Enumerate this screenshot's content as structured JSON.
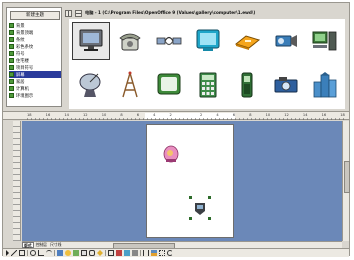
{
  "gallery": {
    "new_theme_label": "新建主题",
    "themes": [
      {
        "label": "背景"
      },
      {
        "label": "背景顶端"
      },
      {
        "label": "条纹"
      },
      {
        "label": "彩色条纹"
      },
      {
        "label": "符号"
      },
      {
        "label": "住宅楼"
      },
      {
        "label": "项目符号"
      },
      {
        "label": "屏幕"
      },
      {
        "label": "家居"
      },
      {
        "label": "计算机"
      },
      {
        "label": "环境图示"
      }
    ],
    "selected_theme_index": 7,
    "path_text": "电脑 - 1 (C:\\Program Files\\OpenOffice 9 (Values\\gallery\\computer\\1.ewd\\)",
    "items": [
      {
        "icon": "computer-monitor-icon"
      },
      {
        "icon": "telephone-icon"
      },
      {
        "icon": "network-cable-icon"
      },
      {
        "icon": "crt-monitor-icon"
      },
      {
        "icon": "disk-drive-icon"
      },
      {
        "icon": "video-camera-icon"
      },
      {
        "icon": "desktop-computer-icon"
      },
      {
        "icon": "satellite-dish-icon"
      },
      {
        "icon": "antenna-tower-icon"
      },
      {
        "icon": "tv-screen-icon"
      },
      {
        "icon": "calculator-icon"
      },
      {
        "icon": "mobile-phone-icon"
      },
      {
        "icon": "camera-icon"
      },
      {
        "icon": "office-building-icon"
      }
    ]
  },
  "ruler": {
    "labels": [
      "18",
      "16",
      "14",
      "12",
      "10",
      "8",
      "6",
      "4",
      "2",
      "",
      "2",
      "4",
      "6",
      "8",
      "10",
      "12",
      "14",
      "16",
      "18"
    ]
  },
  "tabs": [
    {
      "label": "版式"
    },
    {
      "label": "控制层"
    },
    {
      "label": "尺寸线"
    }
  ],
  "active_tab_index": 0,
  "colors": {
    "workspace": "#6b88b8",
    "selection": "#2a3b9c",
    "chrome": "#d9d6cf"
  }
}
